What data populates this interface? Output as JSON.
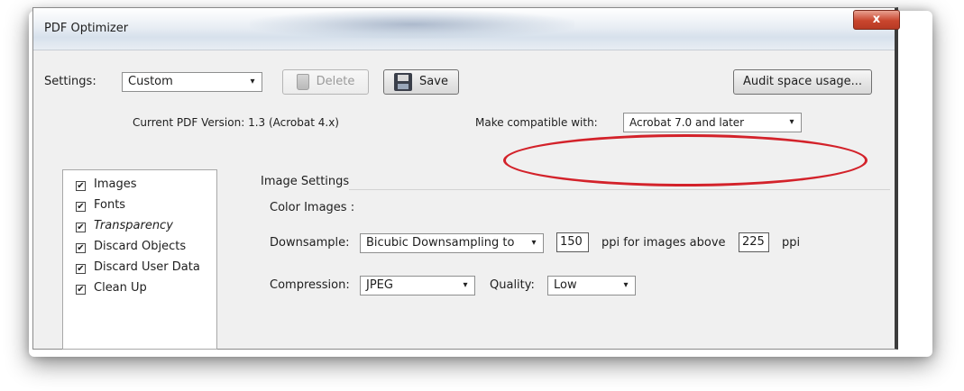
{
  "window": {
    "title": "PDF Optimizer",
    "close_glyph": "x"
  },
  "toolbar": {
    "settings_label": "Settings:",
    "settings_value": "Custom",
    "delete_label": "Delete",
    "save_label": "Save",
    "audit_label": "Audit space usage..."
  },
  "version": {
    "current_text": "Current PDF Version: 1.3 (Acrobat 4.x)",
    "compat_label": "Make compatible with:",
    "compat_value": "Acrobat 7.0 and later"
  },
  "categories": [
    {
      "label": "Images",
      "checked": true
    },
    {
      "label": "Fonts",
      "checked": true
    },
    {
      "label": "Transparency",
      "checked": true
    },
    {
      "label": "Discard Objects",
      "checked": true
    },
    {
      "label": "Discard User Data",
      "checked": true
    },
    {
      "label": "Clean Up",
      "checked": true
    }
  ],
  "image_settings": {
    "heading": "Image Settings",
    "color_images_label": "Color Images :",
    "downsample_label": "Downsample:",
    "downsample_value": "Bicubic Downsampling to",
    "ppi_value": "150",
    "ppi_above_label": "ppi for images above",
    "above_value": "225",
    "ppi_unit": "ppi",
    "compression_label": "Compression:",
    "compression_value": "JPEG",
    "quality_label": "Quality:",
    "quality_value": "Low"
  },
  "icons": {
    "dropdown": "▾",
    "checkmark": "✔"
  },
  "colors": {
    "highlight_ellipse": "#d3222a",
    "close_button": "#c9462e"
  }
}
